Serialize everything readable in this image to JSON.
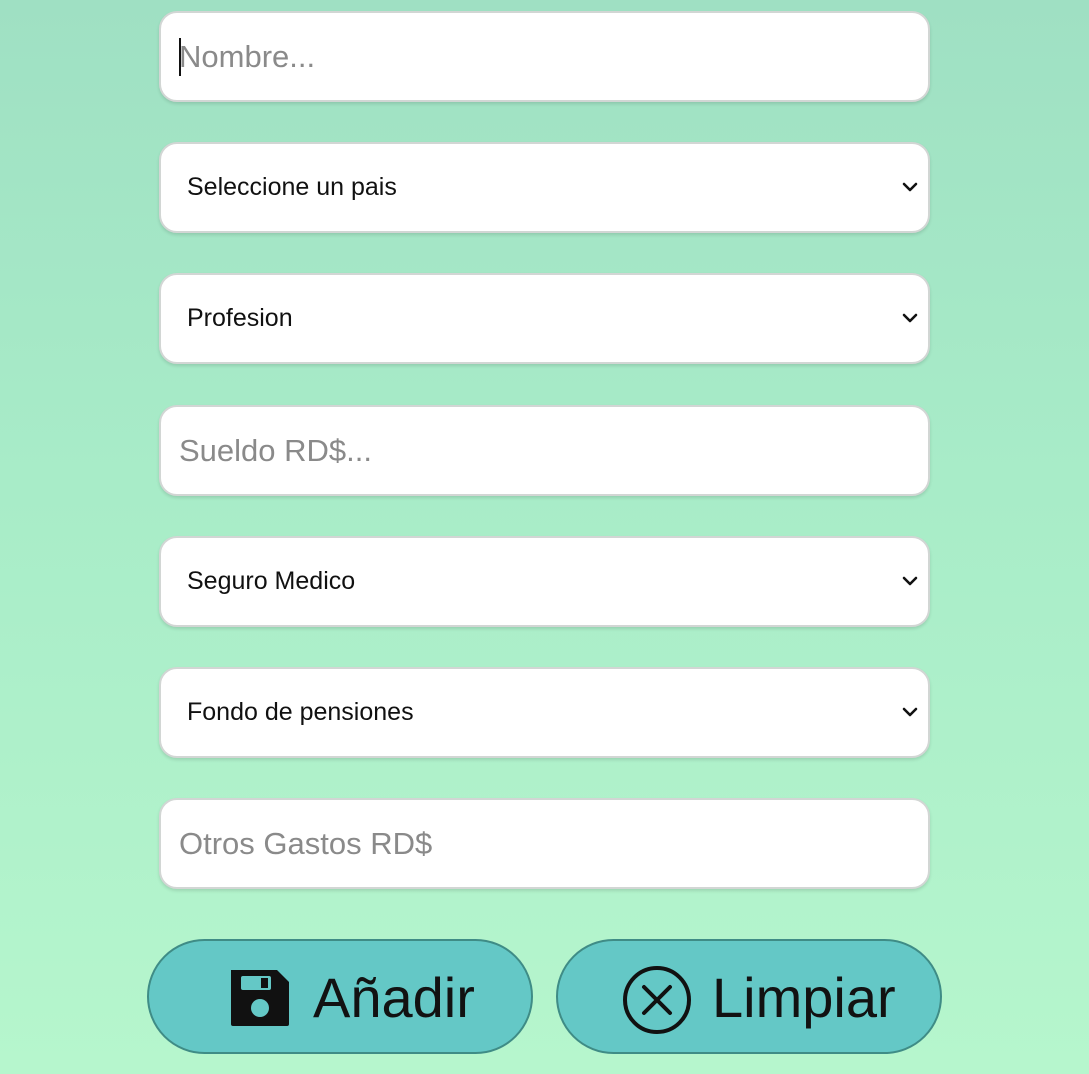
{
  "form": {
    "nombre": {
      "value": "",
      "placeholder": "Nombre..."
    },
    "pais": {
      "selected": "Seleccione un pais"
    },
    "profesion": {
      "selected": "Profesion"
    },
    "sueldo": {
      "value": "",
      "placeholder": "Sueldo RD$..."
    },
    "seguro": {
      "selected": "Seguro Medico"
    },
    "fondo": {
      "selected": "Fondo de pensiones"
    },
    "otros": {
      "value": "",
      "placeholder": "Otros Gastos RD$"
    }
  },
  "buttons": {
    "add": {
      "label": "Añadir",
      "icon": "save-icon"
    },
    "clear": {
      "label": "Limpiar",
      "icon": "x-circle-icon"
    }
  },
  "colors": {
    "button_bg": "#64c8c6",
    "background_top": "#9fe0c3",
    "background_bottom": "#b6f6cd"
  }
}
